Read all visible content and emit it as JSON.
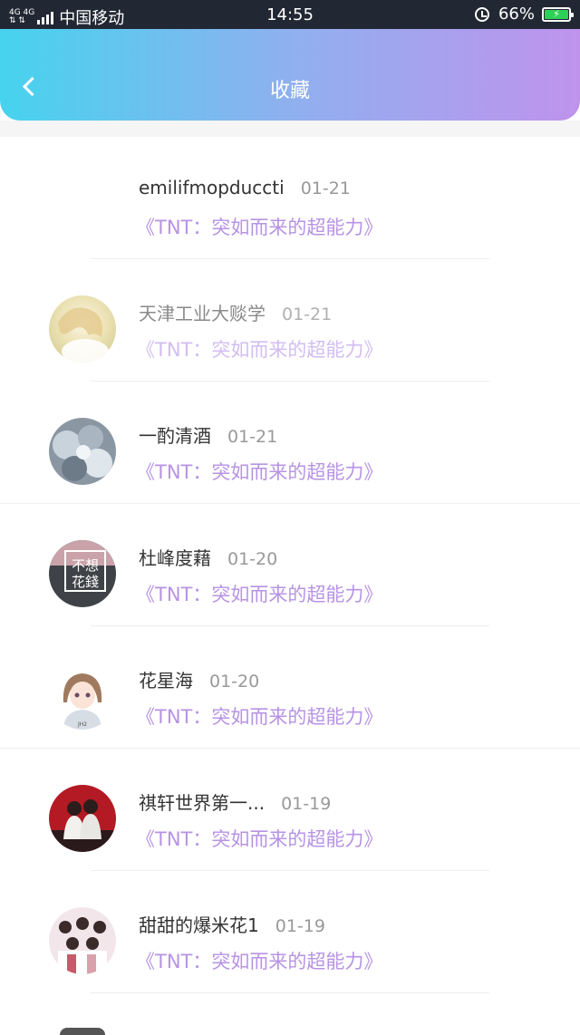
{
  "status_bar": {
    "network_top": "4G 4G",
    "network_bottom": "⇅ ⇅",
    "carrier": "中国移动",
    "time": "14:55",
    "battery": "66%"
  },
  "header": {
    "title": "收藏"
  },
  "items": [
    {
      "name": "emilifmopduccti",
      "date": "01-21",
      "book": "《TNT：突如而来的超能力》"
    },
    {
      "name": "天津工业大赕学",
      "date": "01-21",
      "book": "《TNT：突如而来的超能力》"
    },
    {
      "name": "一酌清酒",
      "date": "01-21",
      "book": "《TNT：突如而来的超能力》"
    },
    {
      "name": "杜峰度藉",
      "date": "01-20",
      "book": "《TNT：突如而来的超能力》",
      "avatar_text": "不想花錢"
    },
    {
      "name": "花星海",
      "date": "01-20",
      "book": "《TNT：突如而来的超能力》"
    },
    {
      "name": "祺轩世界第一...",
      "date": "01-19",
      "book": "《TNT：突如而来的超能力》"
    },
    {
      "name": "甜甜的爆米花1",
      "date": "01-19",
      "book": "《TNT：突如而来的超能力》"
    }
  ]
}
